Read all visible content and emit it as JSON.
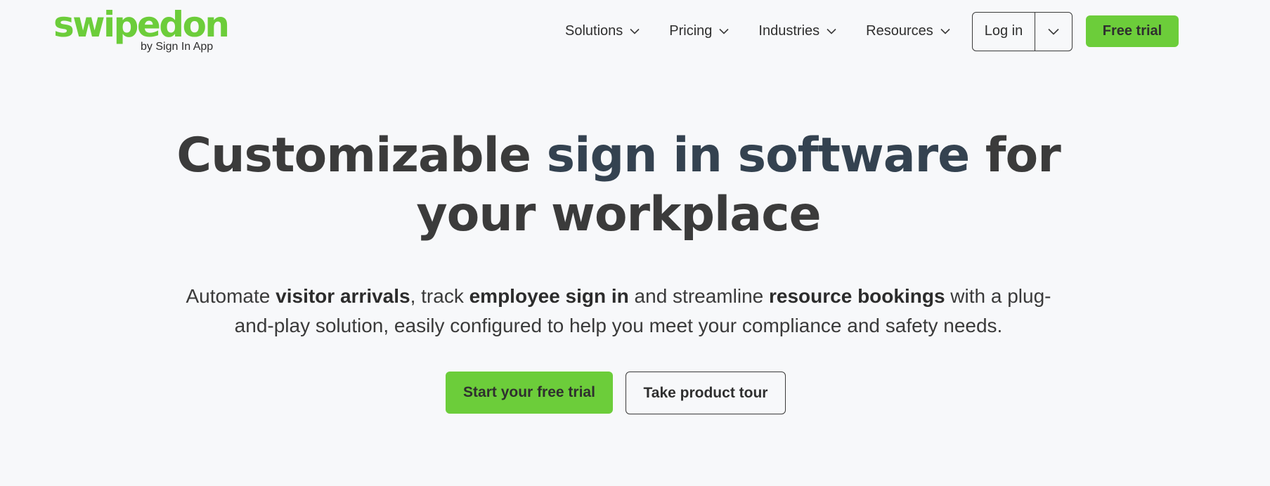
{
  "brand": {
    "name": "swipedon",
    "tagline": "by Sign In App",
    "accent_color": "#6ccd3a"
  },
  "nav": {
    "items": [
      {
        "label": "Solutions",
        "icon": "chevron-down-icon"
      },
      {
        "label": "Pricing",
        "icon": "chevron-down-icon"
      },
      {
        "label": "Industries",
        "icon": "chevron-down-icon"
      },
      {
        "label": "Resources",
        "icon": "chevron-down-icon"
      }
    ],
    "login_label": "Log in",
    "login_menu_icon": "chevron-down-icon",
    "free_trial_label": "Free trial"
  },
  "hero": {
    "title_part1": "Customizable ",
    "title_highlight": "sign in software",
    "title_part2": " for",
    "title_line2": "your workplace",
    "subtitle": {
      "t1": "Automate ",
      "b1": "visitor arrivals",
      "t2": ", track ",
      "b2": "employee sign in",
      "t3": " and streamline ",
      "b3": "resource bookings",
      "t4": " with a plug-",
      "t5": "and-play solution, easily configured to help you meet your compliance and safety needs."
    },
    "cta_primary": "Start your free trial",
    "cta_secondary": "Take product tour"
  }
}
